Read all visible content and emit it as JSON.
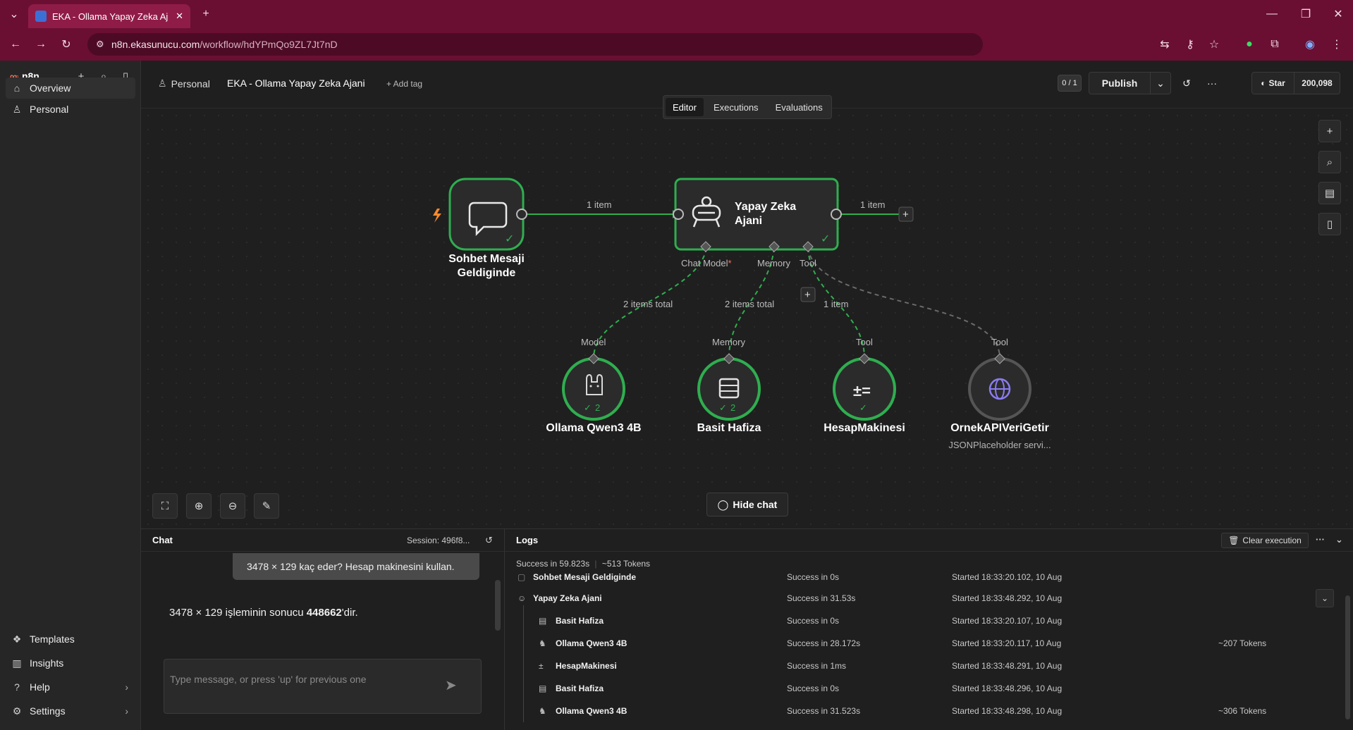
{
  "browser": {
    "tab_title": "EKA - Ollama Yapay Zeka Aj",
    "url_host": "n8n.ekasunucu.com",
    "url_path": "/workflow/hdYPmQo9ZL7Jt7nD"
  },
  "sidebar": {
    "brand": "n8n",
    "items": [
      {
        "label": "Overview"
      },
      {
        "label": "Personal"
      }
    ],
    "bottom_items": [
      {
        "label": "Templates"
      },
      {
        "label": "Insights"
      },
      {
        "label": "Help"
      },
      {
        "label": "Settings"
      }
    ]
  },
  "header": {
    "project": "Personal",
    "workflow_name": "EKA - Ollama Yapay Zeka Ajani",
    "add_tag": "+ Add tag",
    "counter": "0 / 1",
    "publish": "Publish",
    "star": "Star",
    "star_count": "200,098",
    "tabs": [
      "Editor",
      "Executions",
      "Evaluations"
    ]
  },
  "canvas": {
    "nodes": {
      "trigger": {
        "label1": "Sohbet Mesaji",
        "label2": "Geldiginde"
      },
      "agent": {
        "label1": "Yapay Zeka",
        "label2": "Ajani",
        "ports": [
          "Chat Model",
          "Memory",
          "Tool"
        ],
        "required_mark": "*"
      },
      "ollama": {
        "label": "Ollama Qwen3 4B",
        "count": "2",
        "port": "Model"
      },
      "memory": {
        "label": "Basit Hafiza",
        "count": "2",
        "port": "Memory"
      },
      "calc": {
        "label": "HesapMakinesi",
        "port": "Tool"
      },
      "api": {
        "label": "OrnekAPIVeriGetir",
        "sub": "JSONPlaceholder servi...",
        "port": "Tool"
      }
    },
    "connections": {
      "trigger_agent": "1 item",
      "agent_out": "1 item",
      "model": "2 items total",
      "memory": "2 items total",
      "tool": "1 item"
    },
    "hide_chat": "Hide chat"
  },
  "chat": {
    "title": "Chat",
    "session": "Session: 496f8...",
    "user_message": "3478 × 129 kaç eder? Hesap makinesini kullan.",
    "bot_prefix": "3478 × 129 işleminin sonucu ",
    "bot_bold": "448662",
    "bot_suffix": "'dir.",
    "input_placeholder": "Type message, or press 'up' for previous one"
  },
  "logs": {
    "title": "Logs",
    "clear": "Clear execution",
    "summary_success": "Success in 59.823s",
    "summary_tokens": "~513 Tokens",
    "rows": [
      {
        "name": "Sohbet Mesaji Geldiginde",
        "status": "Success in 0s",
        "started": "Started 18:33:20.102, 10 Aug",
        "tokens": ""
      },
      {
        "name": "Yapay Zeka Ajani",
        "status": "Success in 31.53s",
        "started": "Started 18:33:48.292, 10 Aug",
        "tokens": ""
      },
      {
        "name": "Basit Hafiza",
        "status": "Success in 0s",
        "started": "Started 18:33:20.107, 10 Aug",
        "tokens": ""
      },
      {
        "name": "Ollama Qwen3 4B",
        "status": "Success in 28.172s",
        "started": "Started 18:33:20.117, 10 Aug",
        "tokens": "~207 Tokens"
      },
      {
        "name": "HesapMakinesi",
        "status": "Success in 1ms",
        "started": "Started 18:33:48.291, 10 Aug",
        "tokens": ""
      },
      {
        "name": "Basit Hafiza",
        "status": "Success in 0s",
        "started": "Started 18:33:48.296, 10 Aug",
        "tokens": ""
      },
      {
        "name": "Ollama Qwen3 4B",
        "status": "Success in 31.523s",
        "started": "Started 18:33:48.298, 10 Aug",
        "tokens": "~306 Tokens"
      }
    ]
  },
  "colors": {
    "browser_accent": "#6a0f32",
    "success_green": "#2fae4f",
    "node_bg": "#2b2b2b",
    "n8n_brand": "#ff6d5a"
  }
}
